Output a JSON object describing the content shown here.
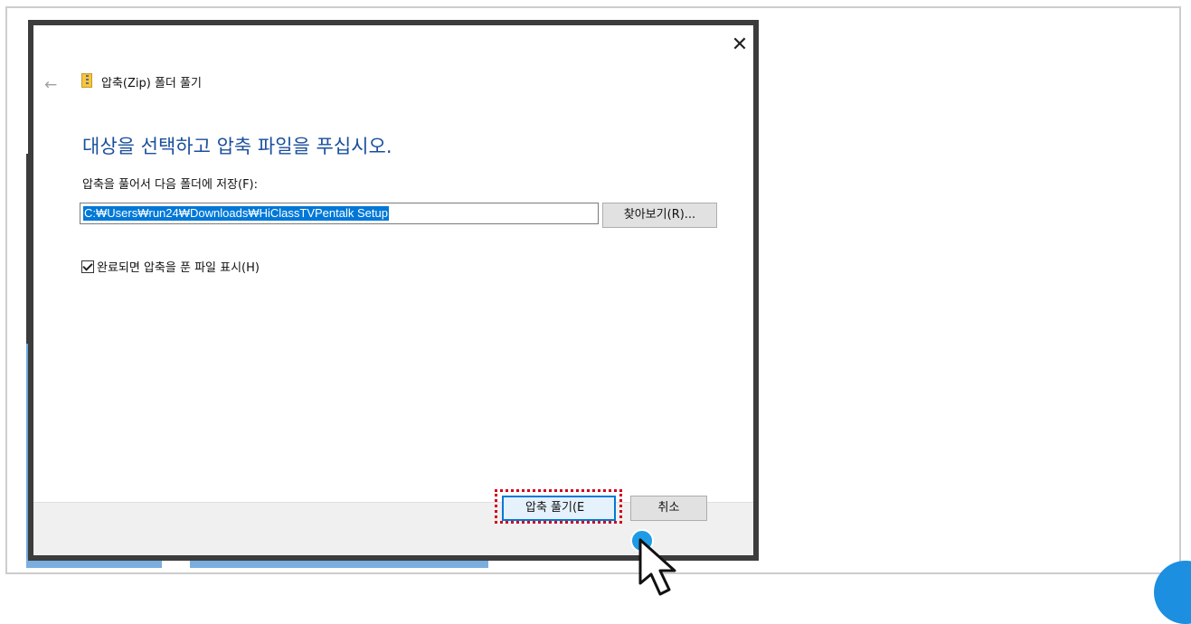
{
  "dialog": {
    "title": "압축(Zip) 폴더 풀기",
    "heading": "대상을 선택하고 압축 파일을 푸십시오.",
    "save_label": "압축을 풀어서 다음 폴더에 저장(F):",
    "path_value": "C:₩Users₩run24₩Downloads₩HiClassTVPentalk Setup",
    "browse_label": "찾아보기(R)...",
    "checkbox_label": "완료되면 압축을 푼 파일 표시(H)",
    "checkbox_checked": true,
    "extract_label": "압축 풀기(E",
    "cancel_label": "취소",
    "close_glyph": "✕",
    "back_glyph": "←"
  },
  "icons": {
    "zip": "zip-folder-icon",
    "cursor": "mouse-pointer-icon"
  },
  "colors": {
    "heading": "#1a4f9c",
    "selection": "#0078d7",
    "highlight": "#d0021b",
    "click_dot": "#1e9be6"
  }
}
